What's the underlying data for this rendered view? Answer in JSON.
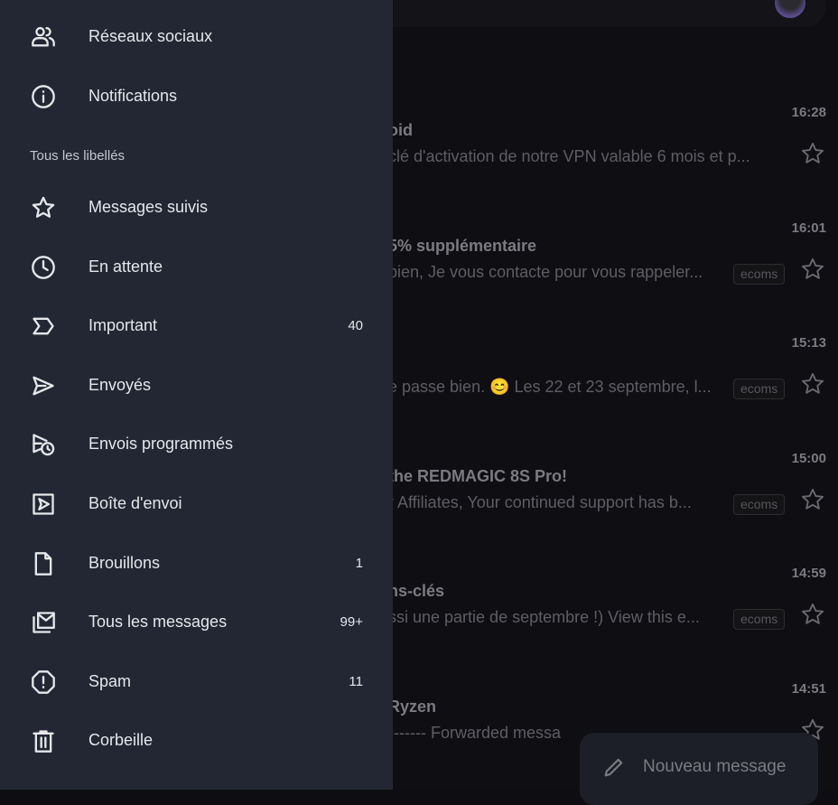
{
  "drawer": {
    "top_items": [
      {
        "label": "Réseaux sociaux",
        "icon": "people-icon"
      },
      {
        "label": "Notifications",
        "icon": "info-icon"
      }
    ],
    "section_label": "Tous les libellés",
    "items": [
      {
        "label": "Messages suivis",
        "icon": "star-icon",
        "count": ""
      },
      {
        "label": "En attente",
        "icon": "clock-icon",
        "count": ""
      },
      {
        "label": "Important",
        "icon": "important-icon",
        "count": "40"
      },
      {
        "label": "Envoyés",
        "icon": "send-icon",
        "count": ""
      },
      {
        "label": "Envois programmés",
        "icon": "scheduled-send-icon",
        "count": ""
      },
      {
        "label": "Boîte d'envoi",
        "icon": "outbox-icon",
        "count": ""
      },
      {
        "label": "Brouillons",
        "icon": "draft-icon",
        "count": "1"
      },
      {
        "label": "Tous les messages",
        "icon": "all-mail-icon",
        "count": "99+"
      },
      {
        "label": "Spam",
        "icon": "spam-icon",
        "count": "11"
      },
      {
        "label": "Corbeille",
        "icon": "trash-icon",
        "count": ""
      }
    ]
  },
  "emails": [
    {
      "time": "16:28",
      "subject": "oid",
      "snippet": "clé d'activation de notre VPN valable 6 mois et p...",
      "tag": ""
    },
    {
      "time": "16:01",
      "subject": " 5% supplémentaire",
      "snippet": "bien, Je vous contacte pour vous rappeler...",
      "tag": "ecoms"
    },
    {
      "time": "15:13",
      "subject": "",
      "snippet": "e passe bien. 😊 Les 22 et 23 septembre, l...",
      "tag": "ecoms"
    },
    {
      "time": "15:00",
      "subject": "the REDMAGIC 8S Pro!",
      "snippet": "r Affiliates, Your continued support has b...",
      "tag": "ecoms"
    },
    {
      "time": "14:59",
      "subject": "ns-clés",
      "snippet": "ssi une partie de septembre !) View this e...",
      "tag": "ecoms"
    },
    {
      "time": "14:51",
      "subject": "Ryzen",
      "snippet": "------- Forwarded messa",
      "tag": ""
    }
  ],
  "compose": {
    "label": "Nouveau message",
    "icon": "pencil-icon"
  },
  "colors": {
    "drawer": "#222733",
    "background": "#0f0f13"
  }
}
